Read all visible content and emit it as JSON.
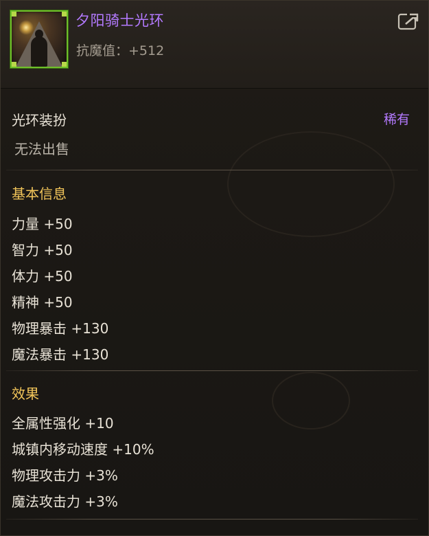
{
  "item": {
    "name": "夕阳骑士光环",
    "sub_stat": "抗魔值：+512",
    "icon": "aura-knight-icon",
    "category": "光环装扮",
    "rarity": "稀有",
    "trade_status": "无法出售"
  },
  "sections": {
    "basic": {
      "title": "基本信息",
      "stats": [
        "力量 +50",
        "智力 +50",
        "体力 +50",
        "精神 +50",
        "物理暴击 +130",
        "魔法暴击 +130"
      ]
    },
    "effect": {
      "title": "效果",
      "stats": [
        "全属性强化 +10",
        "城镇内移动速度 +10%",
        "物理攻击力 +3%",
        "魔法攻击力 +3%"
      ]
    }
  },
  "colors": {
    "rarity_purple": "#b47aff",
    "section_gold": "#f2c55a",
    "stat_white": "#e8e2d6",
    "icon_border": "#6fbf2a"
  }
}
